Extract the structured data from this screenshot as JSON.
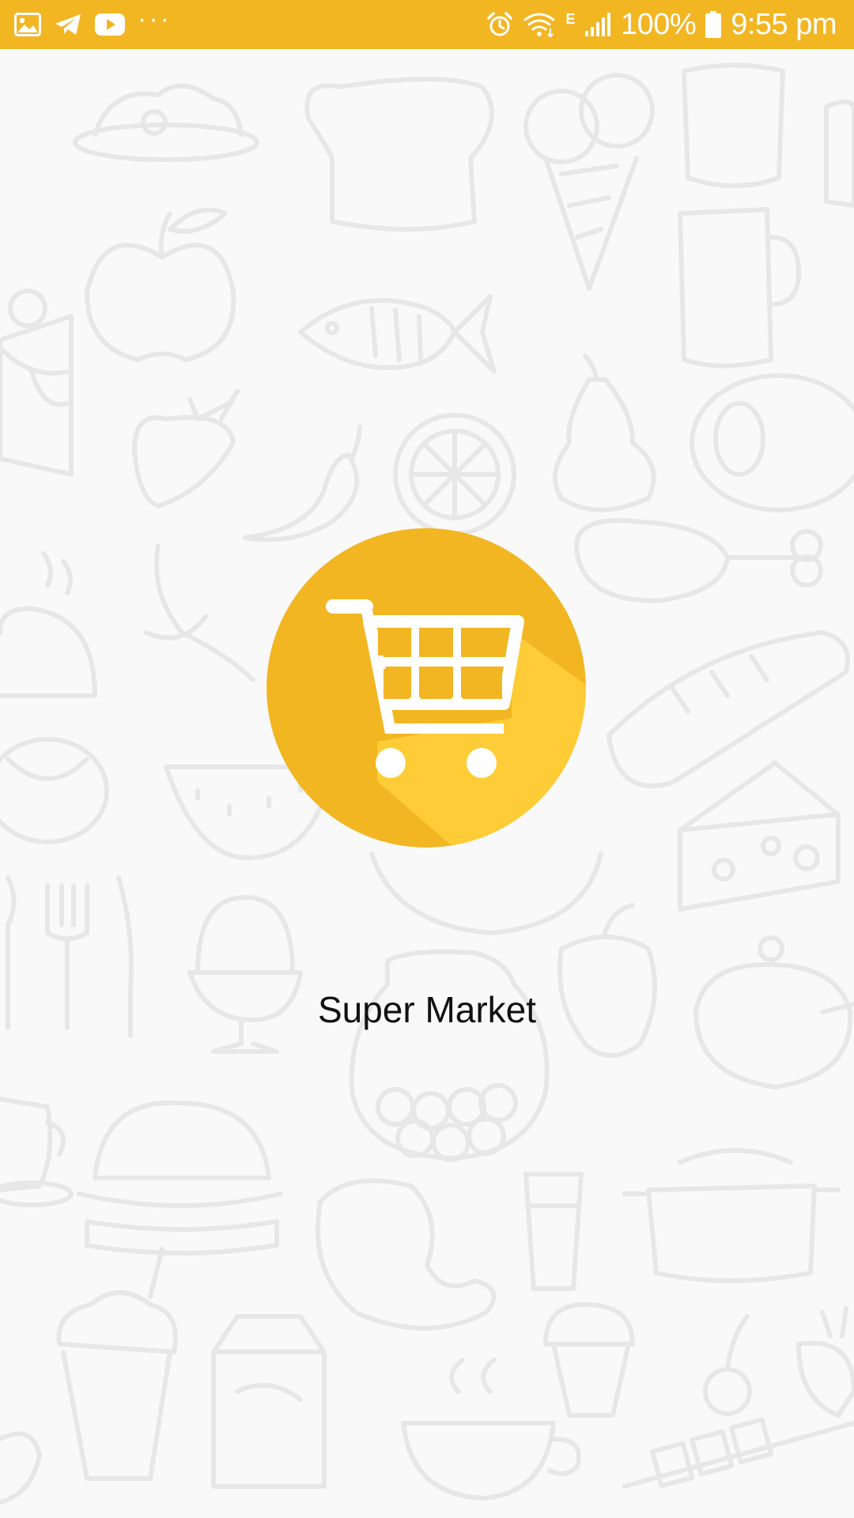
{
  "colors": {
    "status_bar": "#f2b623",
    "accent": "#f2b623",
    "accent_light": "#fecc36",
    "background": "#f9f9f9",
    "doodle_stroke": "#e7e7e7",
    "title_text": "#111111"
  },
  "status_bar": {
    "left_icons": [
      "gallery-icon",
      "telegram-icon",
      "youtube-icon",
      "more-dots-icon"
    ],
    "more_dots": "···",
    "right_icons": [
      "alarm-icon",
      "wifi-icon",
      "signal-icon",
      "battery-icon"
    ],
    "network_type": "E",
    "battery_percent": "100%",
    "time": "9:55 pm"
  },
  "splash": {
    "logo_icon": "shopping-cart-icon",
    "title": "Super Market"
  }
}
